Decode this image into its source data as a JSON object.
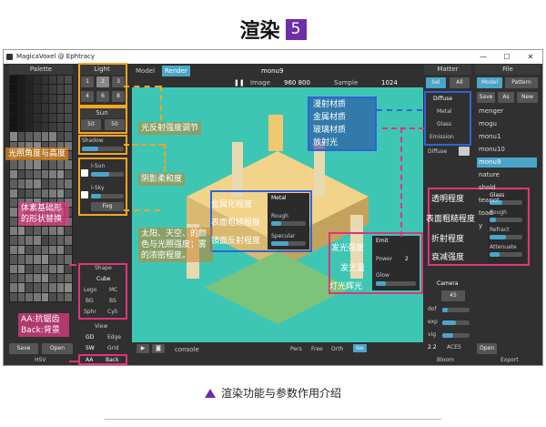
{
  "header": {
    "title": "渲染",
    "badge": "5"
  },
  "caption": "渲染功能与参数作用介绍",
  "window": {
    "title": "MagicaVoxel @ Ephtracy",
    "controls": [
      "—",
      "☐",
      "✕"
    ]
  },
  "left": {
    "palette_title": "Palette",
    "light_title": "Light",
    "light_nums": [
      "1",
      "2",
      "3",
      "4",
      "6",
      "8"
    ],
    "sun_title": "Sun",
    "sun_vals": [
      "50",
      "50"
    ],
    "shadow_label": "Shadow",
    "isun_label": "I-Sun",
    "isky_label": "I-Sky",
    "fog_label": "Fog",
    "save": "Save",
    "open": "Open",
    "hsv": "HSV",
    "shape_title": "Shape",
    "shape_items": [
      "Cube",
      "Lego",
      "MC",
      "BG",
      "BS",
      "Sphr",
      "Cyli"
    ],
    "view_title": "View",
    "view_items": [
      "GD",
      "Edge",
      "SW",
      "Grid"
    ],
    "aa": "AA",
    "back": "Back"
  },
  "toolbar": {
    "model_tab": "Model",
    "render_tab": "Render",
    "file": "monu9",
    "image_label": "Image",
    "image_size": "960 800",
    "sample_label": "Sample",
    "sample_count": "1024"
  },
  "bottom": {
    "console": "console",
    "modes": [
      "Pers",
      "Free",
      "Orth",
      "Iso"
    ]
  },
  "matter": {
    "title": "Matter",
    "sel": "Sel",
    "all": "All",
    "types": [
      "Diffuse",
      "Metal",
      "Glass",
      "Emission"
    ],
    "diffuse_label": "Diffuse",
    "glass_params": [
      "Glass",
      "Rough",
      "Refract",
      "Attenuate"
    ]
  },
  "file_panel": {
    "title": "File",
    "tabs": [
      "Model",
      "Pattern"
    ],
    "actions": [
      "Save",
      "As",
      "New"
    ],
    "items": [
      "menger",
      "mogu",
      "monu1",
      "monu10",
      "monu9",
      "nature",
      "shold",
      "teapot",
      "toad",
      "y"
    ],
    "selected_index": 4,
    "open": "Open",
    "export": "Export"
  },
  "camera": {
    "title": "Camera",
    "fov": "45",
    "params": [
      "dof",
      "exp",
      "vig"
    ],
    "gamma": "2.2",
    "aces": "ACES",
    "bloom": "Bloom"
  },
  "viewport_panels": {
    "metal": {
      "title": "Metal",
      "params": [
        "Rough",
        "Specular"
      ]
    },
    "emit": {
      "title": "Emit",
      "params": [
        "Power",
        "Glow"
      ],
      "power_val": "2"
    }
  },
  "annotations": {
    "light_intensity": "光反射强度调节",
    "light_angle": "光照角度与高度",
    "shadow_soft": "阴影柔和度",
    "sun_sky": "太阳、天空、的颜色与光照强度；雾的浓密程度。",
    "shape": "体素基础形的形状替换",
    "aa_back": "AA:抗锯齿 Back:背景",
    "metal": [
      "金属化程度",
      "表面粗糙程度",
      "镜面反射程度"
    ],
    "material": [
      "漫射材质",
      "金属材质",
      "玻璃材质",
      "放射光"
    ],
    "emit": [
      "发光强度",
      "发光量",
      "灯光辉光"
    ],
    "glass": [
      "透明程度",
      "表面粗糙程度",
      "折射程度",
      "衰减强度"
    ]
  },
  "colors": {
    "orange": "#f5a623",
    "pink": "#e0347a",
    "blue": "#2e64d8",
    "purple": "#6d2ea8",
    "accent": "#4aa6c9"
  }
}
